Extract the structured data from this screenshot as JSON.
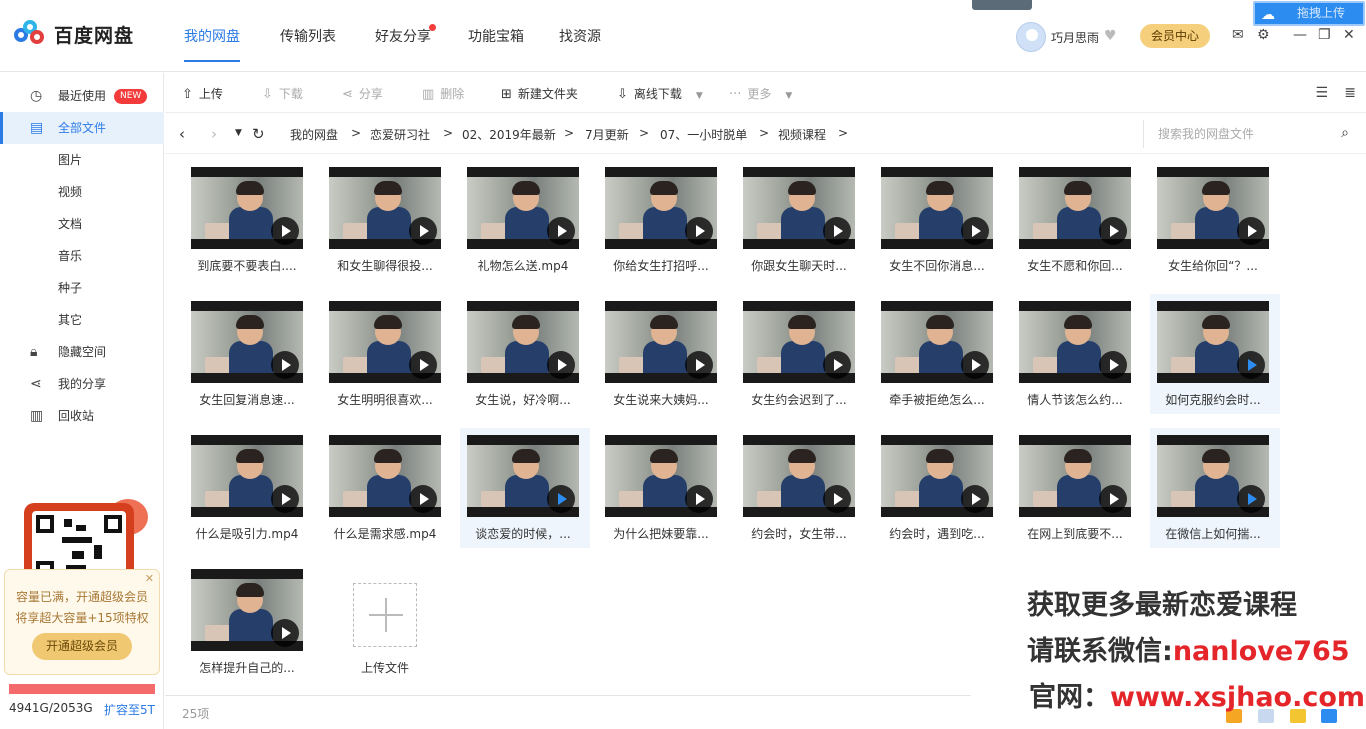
{
  "app": {
    "title": "百度网盘"
  },
  "nav": {
    "tabs": [
      "我的网盘",
      "传输列表",
      "好友分享",
      "功能宝箱",
      "找资源"
    ],
    "active": 0
  },
  "user": {
    "name": "巧月思雨",
    "member_label": "会员中心"
  },
  "drag_upload_label": "拖拽上传",
  "sidebar": {
    "items": [
      {
        "label": "最近使用",
        "icon": "clock-icon",
        "badge": "NEW"
      },
      {
        "label": "全部文件",
        "icon": "file-icon"
      },
      {
        "label": "图片"
      },
      {
        "label": "视频"
      },
      {
        "label": "文档"
      },
      {
        "label": "音乐"
      },
      {
        "label": "种子"
      },
      {
        "label": "其它"
      },
      {
        "label": "隐藏空间",
        "icon": "lock-icon"
      },
      {
        "label": "我的分享",
        "icon": "share-icon"
      },
      {
        "label": "回收站",
        "icon": "trash-icon"
      }
    ],
    "promo_line1": "容量已满，开通超级会员",
    "promo_line2": "将享超大容量+15项特权",
    "promo_button": "开通超级会员",
    "capacity": "4941G/2053G",
    "expand_label": "扩容至5T"
  },
  "toolbar": {
    "upload": "上传",
    "download": "下载",
    "share": "分享",
    "delete": "删除",
    "new_folder": "新建文件夹",
    "offline_download": "离线下载",
    "more": "更多"
  },
  "breadcrumb": [
    "我的网盘",
    "恋爱研习社",
    "02、2019年最新",
    "7月更新",
    "07、一小时脱单",
    "视频课程"
  ],
  "search": {
    "placeholder": "搜索我的网盘文件"
  },
  "files": [
    "到底要不要表白....",
    "和女生聊得很投...",
    "礼物怎么送.mp4",
    "你给女生打招呼...",
    "你跟女生聊天时...",
    "女生不回你消息...",
    "女生不愿和你回...",
    "女生给你回“？...",
    "女生回复消息速...",
    "女生明明很喜欢...",
    "女生说，好冷啊...",
    "女生说来大姨妈...",
    "女生约会迟到了...",
    "牵手被拒绝怎么...",
    "情人节该怎么约...",
    "如何克服约会时...",
    "什么是吸引力.mp4",
    "什么是需求感.mp4",
    "谈恋爱的时候，...",
    "为什么把妹要靠...",
    "约会时，女生带...",
    "约会时，遇到吃...",
    "在网上到底要不...",
    "在微信上如何揣...",
    "怎样提升自己的..."
  ],
  "highlighted_files": [
    15,
    18,
    23
  ],
  "upload_tile_label": "上传文件",
  "status": {
    "count": "25项"
  },
  "watermark": {
    "line1": "获取更多最新恋爱课程",
    "line2_prefix": "请联系微信:",
    "line2_value": "nanlove765",
    "line3_prefix": "官网：",
    "line3_value": "www.xsjhao.com"
  },
  "colors": {
    "accent": "#2d7be5",
    "badge": "#f33b3b",
    "watermark_red": "#e4262a"
  }
}
